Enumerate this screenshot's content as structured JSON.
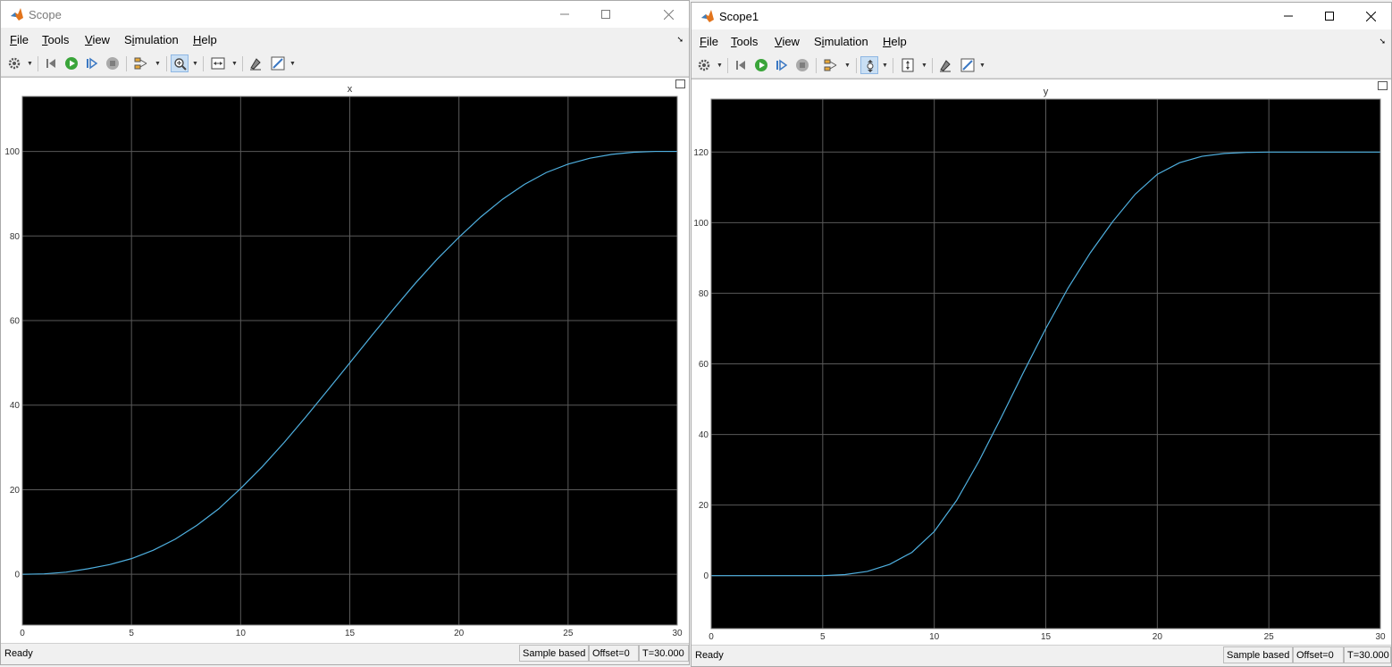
{
  "menu": {
    "file": {
      "hot": "F",
      "rest": "ile"
    },
    "tools": {
      "hot": "T",
      "rest": "ools"
    },
    "view": {
      "hot": "V",
      "rest": "iew"
    },
    "simulation": {
      "pre": "S",
      "hot": "i",
      "rest": "mulation"
    },
    "help": {
      "hot": "H",
      "rest": "elp"
    }
  },
  "colors": {
    "plot_bg": "#000000",
    "grid": "#5a5a5a",
    "line": "#4fb0e0"
  },
  "icons": [
    "settings-icon",
    "step-back-icon",
    "run-icon",
    "step-forward-icon",
    "stop-icon",
    "signal-select-icon",
    "zoom-in-icon",
    "zoom-y-icon",
    "fit-axes-icon",
    "fit-y-icon",
    "highlight-icon",
    "style-icon"
  ],
  "windows": [
    {
      "title": "Scope",
      "status": {
        "ready": "Ready",
        "sample": "Sample based",
        "offset": "Offset=0",
        "time": "T=30.000"
      }
    },
    {
      "title": "Scope1",
      "status": {
        "ready": "Ready",
        "sample": "Sample based",
        "offset": "Offset=0",
        "time": "T=30.000"
      }
    }
  ],
  "chart_data": [
    {
      "type": "line",
      "title": "x",
      "xlim": [
        0,
        30
      ],
      "ylim": [
        -12,
        113
      ],
      "x_ticks": [
        0,
        5,
        10,
        15,
        20,
        25,
        30
      ],
      "y_ticks": [
        0,
        20,
        40,
        60,
        80,
        100
      ],
      "grid": true,
      "x": [
        0,
        1,
        2,
        3,
        4,
        5,
        6,
        7,
        8,
        9,
        10,
        11,
        12,
        13,
        14,
        15,
        16,
        17,
        18,
        19,
        20,
        21,
        22,
        23,
        24,
        25,
        26,
        27,
        28,
        29,
        30
      ],
      "y": [
        0,
        0.1,
        0.5,
        1.3,
        2.3,
        3.7,
        5.7,
        8.3,
        11.6,
        15.5,
        20.3,
        25.5,
        31.2,
        37.3,
        43.6,
        50,
        56.4,
        62.7,
        68.8,
        74.5,
        79.7,
        84.5,
        88.7,
        92.2,
        95,
        97,
        98.4,
        99.3,
        99.8,
        100,
        100
      ]
    },
    {
      "type": "line",
      "title": "y",
      "xlim": [
        0,
        30
      ],
      "ylim": [
        -15,
        135
      ],
      "x_ticks": [
        0,
        5,
        10,
        15,
        20,
        25,
        30
      ],
      "y_ticks": [
        0,
        20,
        40,
        60,
        80,
        100,
        120
      ],
      "grid": true,
      "x": [
        0,
        1,
        2,
        3,
        4,
        5,
        6,
        7,
        8,
        9,
        10,
        11,
        12,
        13,
        14,
        15,
        16,
        17,
        18,
        19,
        20,
        21,
        22,
        23,
        24,
        25,
        26,
        27,
        28,
        29,
        30
      ],
      "y": [
        0,
        0,
        0,
        0,
        0,
        0,
        0.3,
        1.2,
        3.2,
        6.6,
        12.5,
        21.3,
        32.4,
        44.8,
        57.6,
        70,
        81.5,
        91.5,
        100.3,
        108,
        113.7,
        117,
        118.8,
        119.6,
        119.9,
        120,
        120,
        120,
        120,
        120,
        120
      ]
    }
  ]
}
